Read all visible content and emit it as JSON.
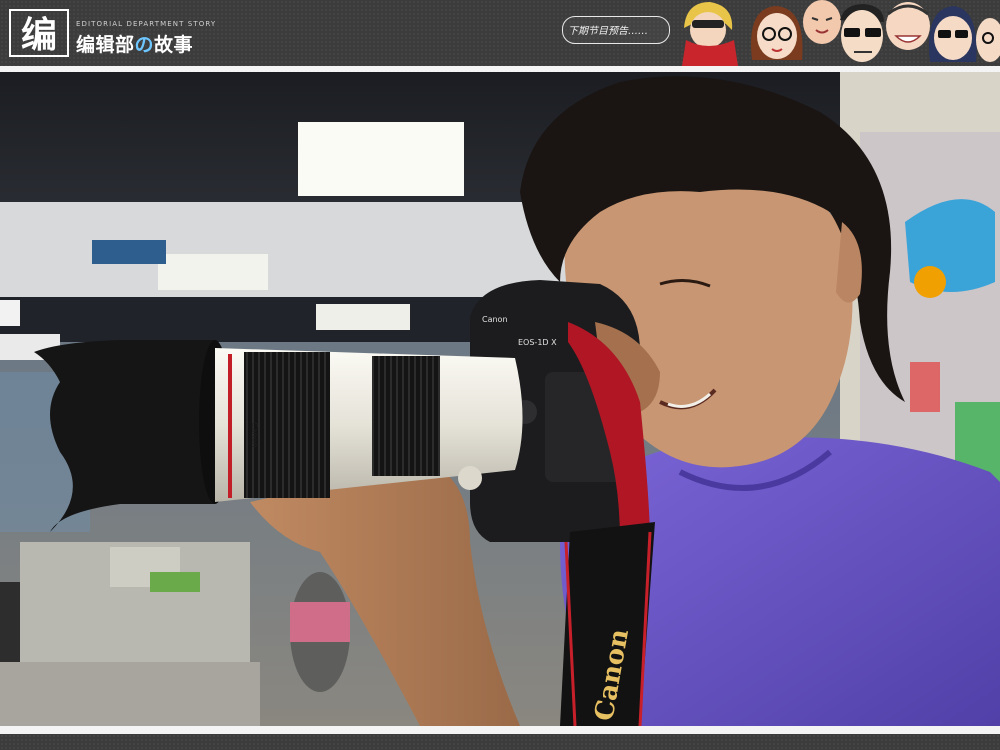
{
  "header": {
    "logo_glyph": "编",
    "brand_en": "EDITORIAL DEPARTMENT STORY",
    "brand_cn_a": "编辑部",
    "brand_cn_no": "の",
    "brand_cn_b": "故事",
    "bubble_text": "下期节目预告……",
    "characters": [
      "blonde-sunglasses-red-scarf",
      "girl-glasses",
      "bald-man",
      "man-sunglasses",
      "smiling-man",
      "woman-sunglasses",
      "man-glasses"
    ]
  },
  "photo": {
    "subject": "photographer-with-telephoto-lens",
    "lens_brand": "Canon",
    "camera_model": "EOS-1D X",
    "strap_text": "Canon"
  },
  "colors": {
    "header_bg": "#3c3c3c",
    "frame": "#f4f4f4",
    "shirt": "#6b55c8",
    "lens_white": "#e9e7df"
  }
}
